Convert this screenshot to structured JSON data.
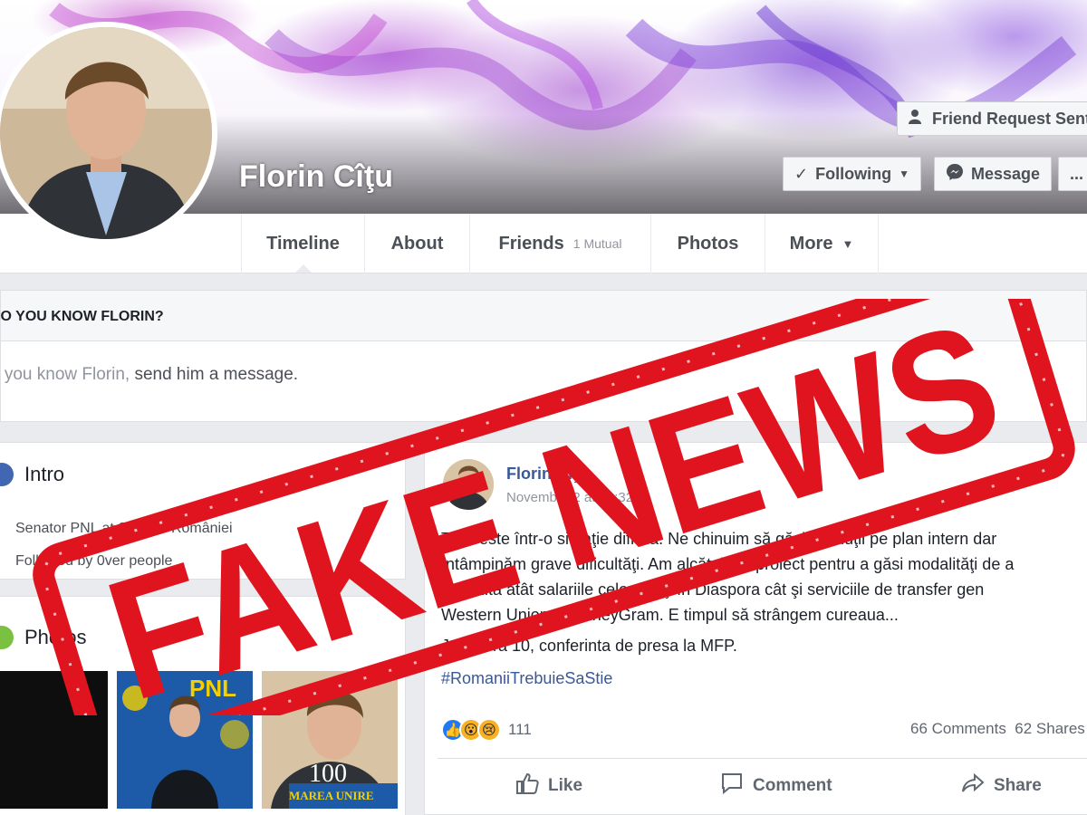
{
  "cover": {
    "buttons": {
      "friend_request": "Friend Request Sent",
      "following": "Following",
      "message": "Message",
      "more": "..."
    }
  },
  "profile": {
    "name": "Florin Cîţu"
  },
  "nav": {
    "tabs": {
      "timeline": "Timeline",
      "about": "About",
      "friends": "Friends",
      "friends_count": "1 Mutual",
      "photos": "Photos",
      "more": "More"
    }
  },
  "know": {
    "title": "DO YOU KNOW FLORIN?",
    "body_prefix": "If you know Florin,",
    "body_suffix": "send him a message."
  },
  "intro": {
    "title": "Intro",
    "line1": "Senator PNL at Senatul României",
    "line2": "Followed by 0ver people"
  },
  "photos": {
    "title": "Photos",
    "thumb2_logo": "PNL",
    "thumb3_caption_num": "100",
    "thumb3_caption": "MAREA UNIRE"
  },
  "post": {
    "author": "Florin Cîţu",
    "date": "November 2 at 12:32",
    "lines": [
      "Ţara este într-o situaţie dificilă. Ne chinuim să găsim soluţii pe plan intern dar",
      "întâmpinăm grave dificultăţi. Am alcătuit un proiect pentru a găsi modalităţi de a",
      "impozita atât salariile celor aflaţi în Diaspora cât şi serviciile de transfer gen",
      "Western Union şi MoneyGram. E timpul să strângem cureaua..."
    ],
    "press": "Joi la ora 10, conferinta de presa la MFP.",
    "hashtag": "#RomaniiTrebuieSaStie",
    "reactions_count": "111",
    "comments": "66 Comments",
    "shares": "62 Shares",
    "actions": {
      "like": "Like",
      "comment": "Comment",
      "share": "Share"
    }
  },
  "stamp": {
    "text": "FAKE NEWS",
    "color": "#e0141e"
  },
  "colors": {
    "facebook_blue": "#385898",
    "background": "#e9ebee"
  }
}
